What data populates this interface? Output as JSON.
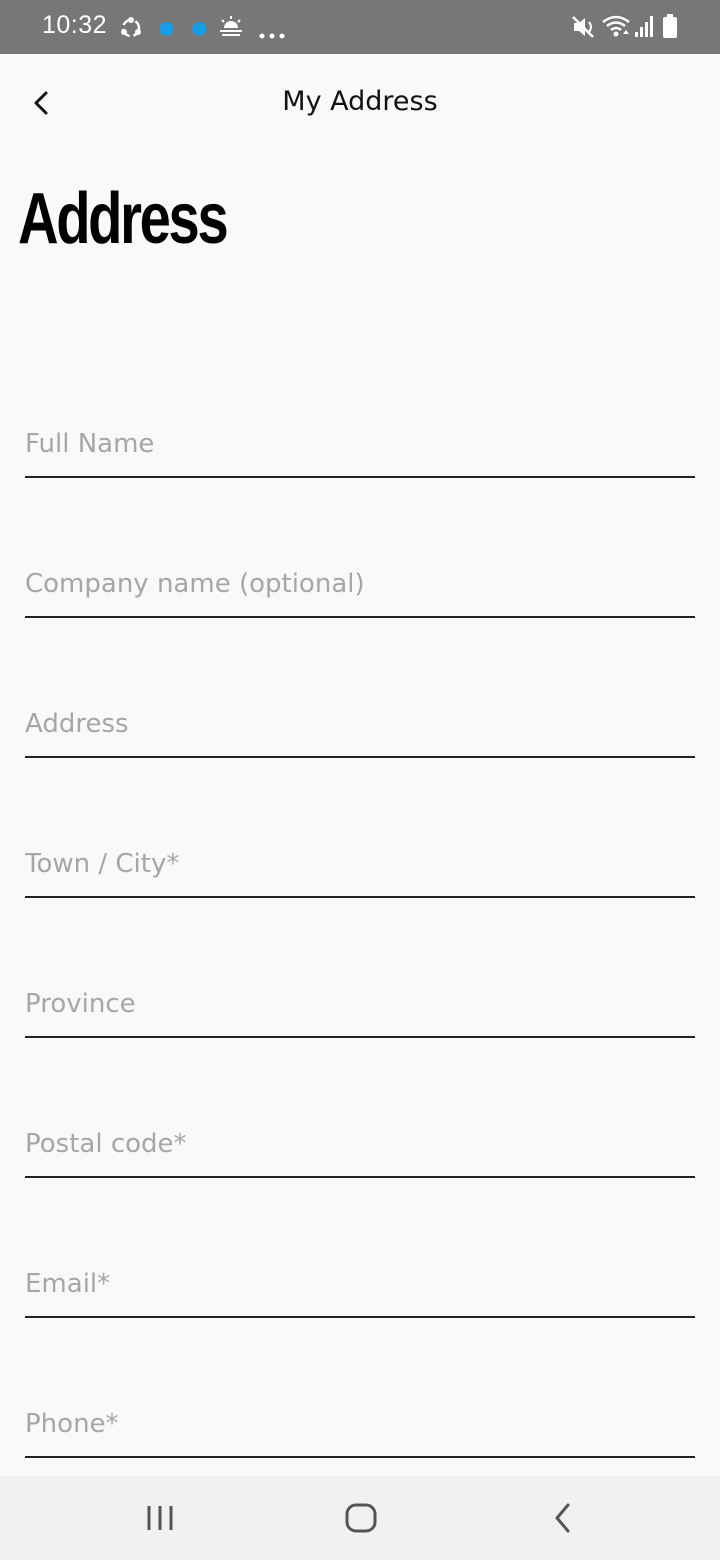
{
  "status_bar": {
    "time": "10:32",
    "icons": [
      "sync-icon",
      "notification-dot-icon",
      "notification-dot-icon",
      "weather-icon",
      "more-dots-icon",
      "mute-icon",
      "wifi-icon",
      "signal-icon",
      "battery-icon"
    ],
    "notification_dot_color": "#1a9be6"
  },
  "app_bar": {
    "title": "My Address",
    "back_icon": "chevron-left-icon"
  },
  "page": {
    "heading": "Address"
  },
  "form": {
    "full_name": {
      "value": "",
      "placeholder": "Full Name"
    },
    "company_name": {
      "value": "",
      "placeholder": "Company name (optional)"
    },
    "address": {
      "value": "",
      "placeholder": "Address"
    },
    "town_city": {
      "value": "",
      "placeholder": "Town / City*"
    },
    "province": {
      "value": "",
      "placeholder": "Province"
    },
    "postal_code": {
      "value": "",
      "placeholder": "Postal code*"
    },
    "email": {
      "value": "",
      "placeholder": "Email*"
    },
    "phone": {
      "value": "",
      "placeholder": "Phone*"
    }
  },
  "nav_bar": {
    "buttons": [
      "recents-icon",
      "home-icon",
      "back-icon"
    ]
  },
  "colors": {
    "background": "#f9f9f9",
    "status_bar": "#777777",
    "placeholder": "#a6a6a6",
    "underline": "#222222",
    "nav_bar": "#f1f1f1"
  }
}
